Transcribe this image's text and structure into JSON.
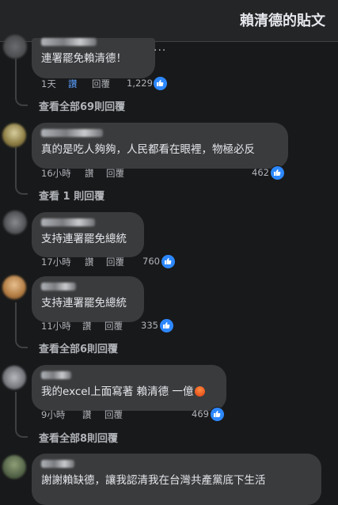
{
  "header": {
    "title": "賴清德的貼文"
  },
  "comments": [
    {
      "text": "連署罷免賴清德！",
      "time": "1天",
      "like_label": "讚",
      "reply_label": "回覆",
      "reaction_count": "1,229",
      "view_replies": "查看全部69則回覆"
    },
    {
      "text": "真的是吃人夠夠，人民都看在眼裡，物極必反",
      "time": "16小時",
      "like_label": "讚",
      "reply_label": "回覆",
      "reaction_count": "462",
      "view_replies": "查看 1 則回覆"
    },
    {
      "text": "支持連署罷免總統",
      "time": "17小時",
      "like_label": "讚",
      "reply_label": "回覆",
      "reaction_count": "760"
    },
    {
      "text": "支持連署罷免總統",
      "time": "11小時",
      "like_label": "讚",
      "reply_label": "回覆",
      "reaction_count": "335",
      "view_replies": "查看全部6則回覆"
    },
    {
      "text": "我的excel上面寫著 賴清德 一億",
      "time": "9小時",
      "like_label": "讚",
      "reply_label": "回覆",
      "reaction_count": "469",
      "view_replies": "查看全部8則回覆"
    },
    {
      "text": "謝謝賴缺德，讓我認清我在台灣共產黨底下生活"
    }
  ],
  "icons": {
    "like": "like-thumb-icon",
    "angry": "angry-emoji-icon",
    "more": "more-options-icon"
  },
  "colors": {
    "background": "#18191a",
    "bubble": "#3a3b3c",
    "like_blue": "#2d88ff",
    "text_secondary": "#b0b3b8"
  }
}
